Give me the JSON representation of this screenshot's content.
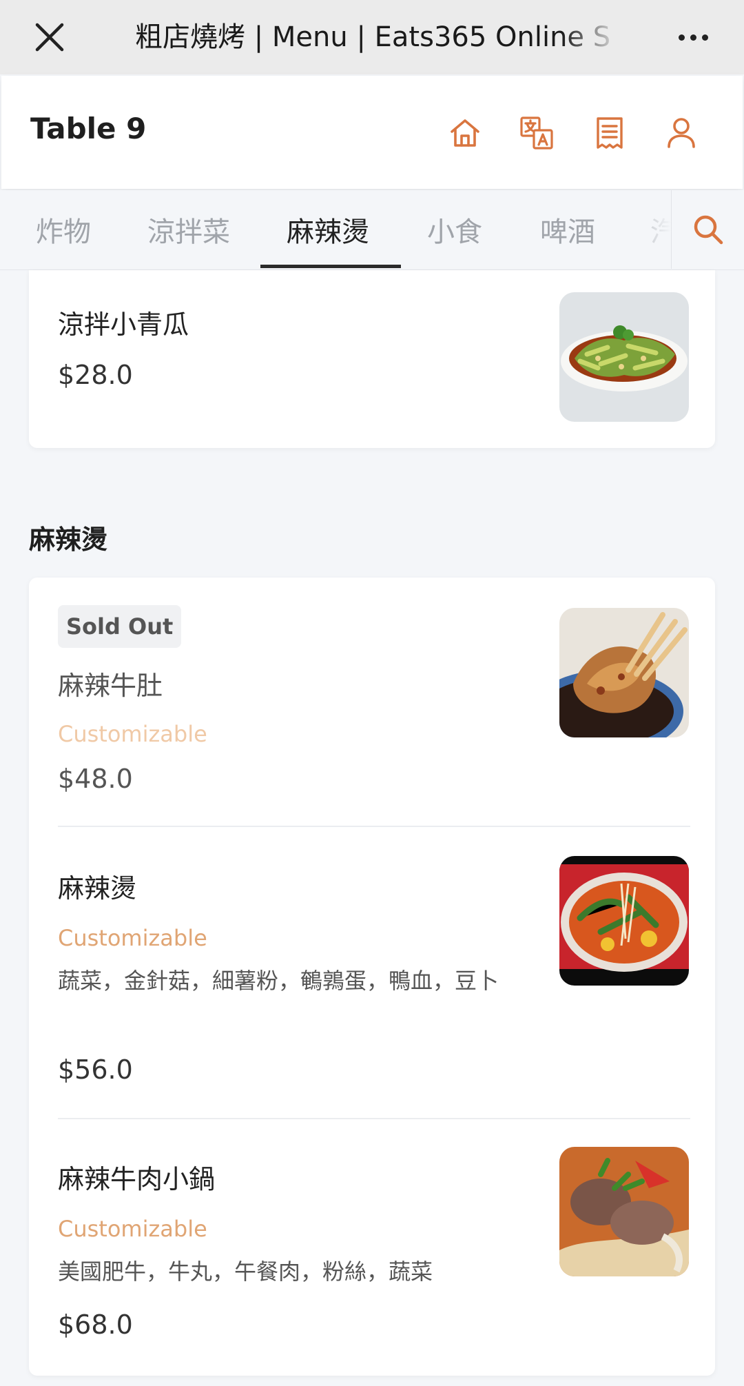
{
  "browser": {
    "title": "粗店燒烤 | Menu | Eats365 Online S",
    "close_icon": "close-icon",
    "more_icon": "more-horizontal-icon"
  },
  "header": {
    "table_label": "Table 9",
    "icons": [
      "home-icon",
      "translate-icon",
      "receipt-icon",
      "user-icon"
    ],
    "accent_color": "#d9753f"
  },
  "tabs": {
    "items": [
      "炸物",
      "涼拌菜",
      "麻辣燙",
      "小食",
      "啤酒",
      "汽"
    ],
    "active": "麻辣燙",
    "search_icon": "search-icon"
  },
  "previous_card": {
    "name": "涼拌小青瓜",
    "price": "$28.0"
  },
  "section": {
    "title": "麻辣燙",
    "items": [
      {
        "badge": "Sold Out",
        "name": "麻辣牛肚",
        "customizable": "Customizable",
        "price": "$48.0"
      },
      {
        "name": "麻辣燙",
        "customizable": "Customizable",
        "description": "蔬菜，金針菇，細薯粉，鵪鶉蛋，鴨血，豆卜",
        "price": "$56.0"
      },
      {
        "name": "麻辣牛肉小鍋",
        "customizable": "Customizable",
        "description": "美國肥牛，牛丸，午餐肉，粉絲，蔬菜",
        "price": "$68.0"
      }
    ]
  }
}
